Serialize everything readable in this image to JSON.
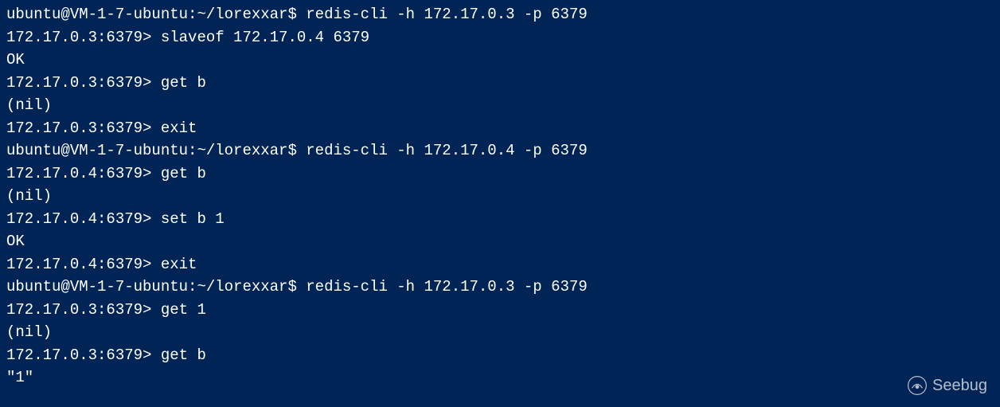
{
  "lines": [
    "ubuntu@VM-1-7-ubuntu:~/lorexxar$ redis-cli -h 172.17.0.3 -p 6379",
    "172.17.0.3:6379> slaveof 172.17.0.4 6379",
    "OK",
    "172.17.0.3:6379> get b",
    "(nil)",
    "172.17.0.3:6379> exit",
    "ubuntu@VM-1-7-ubuntu:~/lorexxar$ redis-cli -h 172.17.0.4 -p 6379",
    "172.17.0.4:6379> get b",
    "(nil)",
    "172.17.0.4:6379> set b 1",
    "OK",
    "172.17.0.4:6379> exit",
    "ubuntu@VM-1-7-ubuntu:~/lorexxar$ redis-cli -h 172.17.0.3 -p 6379",
    "172.17.0.3:6379> get 1",
    "(nil)",
    "172.17.0.3:6379> get b",
    "\"1\""
  ],
  "watermark": {
    "text": "Seebug"
  }
}
